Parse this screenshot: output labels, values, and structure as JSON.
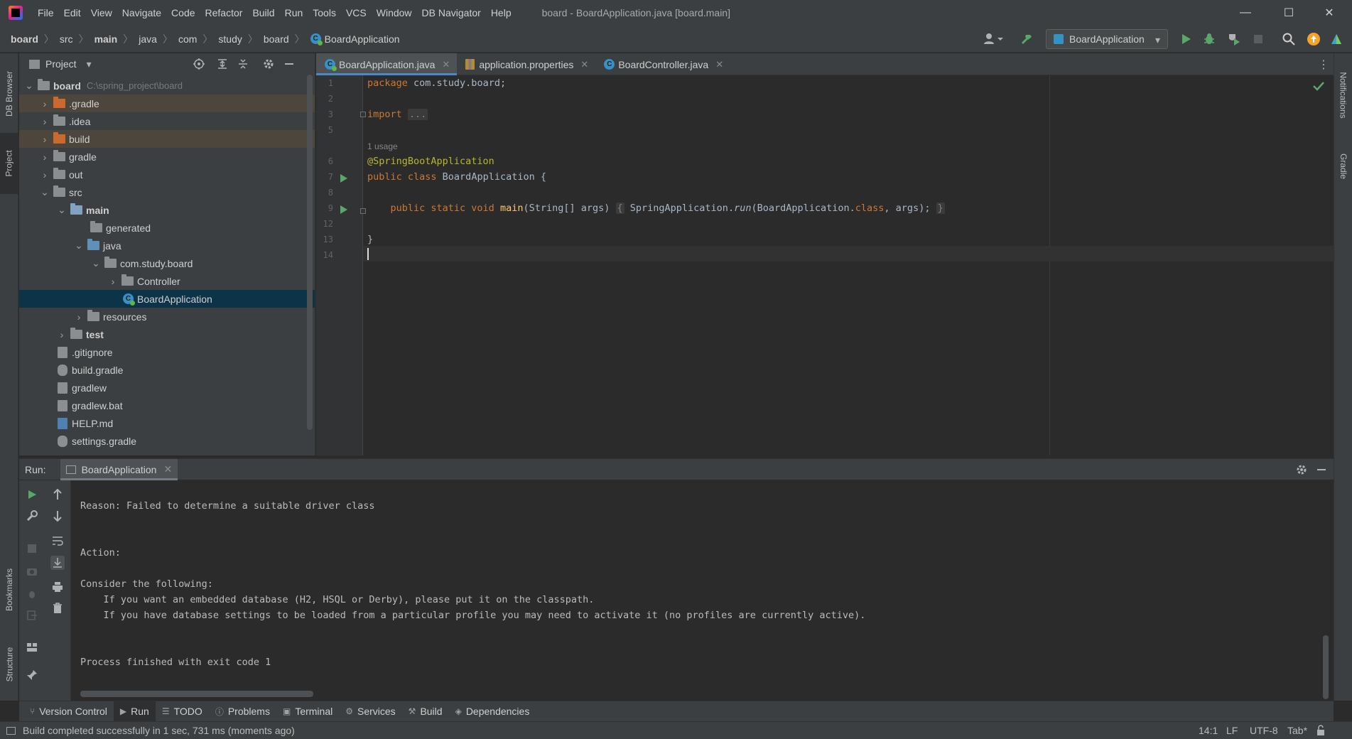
{
  "titlebar": {
    "menu": [
      "File",
      "Edit",
      "View",
      "Navigate",
      "Code",
      "Refactor",
      "Build",
      "Run",
      "Tools",
      "VCS",
      "Window",
      "DB Navigator",
      "Help"
    ],
    "window_title": "board - BoardApplication.java [board.main]",
    "minimize": "—",
    "maximize": "☐",
    "close": "✕"
  },
  "breadcrumb": {
    "items": [
      "board",
      "src",
      "main",
      "java",
      "com",
      "study",
      "board",
      "BoardApplication"
    ],
    "bold": [
      "board",
      "main"
    ]
  },
  "toolbar": {
    "run_config": "BoardApplication",
    "accent_run": "#59a869",
    "accent_update": "#f4a32b"
  },
  "left_strip": {
    "db_browser": "DB Browser",
    "project": "Project",
    "bookmarks": "Bookmarks",
    "structure": "Structure"
  },
  "right_strip": {
    "notifications": "Notifications",
    "gradle": "Gradle"
  },
  "project": {
    "title": "Project",
    "root_name": "board",
    "root_path": "C:\\spring_project\\board",
    "rows": [
      {
        "label": ".gradle",
        "icon": "folder-orange"
      },
      {
        "label": ".idea",
        "icon": "folder-gray"
      },
      {
        "label": "build",
        "icon": "folder-orange"
      },
      {
        "label": "gradle",
        "icon": "folder-gray"
      },
      {
        "label": "out",
        "icon": "folder-gray"
      },
      {
        "label": "src",
        "icon": "folder-gray"
      },
      {
        "label": "main",
        "icon": "folder-gray"
      },
      {
        "label": "generated",
        "icon": "folder-generated"
      },
      {
        "label": "java",
        "icon": "folder-blue"
      },
      {
        "label": "com.study.board",
        "icon": "package"
      },
      {
        "label": "Controller",
        "icon": "package"
      },
      {
        "label": "BoardApplication",
        "icon": "spring-class"
      },
      {
        "label": "resources",
        "icon": "folder-resources"
      },
      {
        "label": "test",
        "icon": "folder-gray"
      },
      {
        "label": ".gitignore",
        "icon": "gitignore-file"
      },
      {
        "label": "build.gradle",
        "icon": "gradle-file"
      },
      {
        "label": "gradlew",
        "icon": "shell-file"
      },
      {
        "label": "gradlew.bat",
        "icon": "bat-file"
      },
      {
        "label": "HELP.md",
        "icon": "markdown-file"
      },
      {
        "label": "settings.gradle",
        "icon": "gradle-file"
      }
    ]
  },
  "editor": {
    "tabs": [
      {
        "label": "BoardApplication.java",
        "active": true
      },
      {
        "label": "application.properties",
        "active": false
      },
      {
        "label": "BoardController.java",
        "active": false
      }
    ],
    "line_numbers": [
      "1",
      "2",
      "3",
      "5",
      "6",
      "7",
      "8",
      "9",
      "12",
      "13",
      "14"
    ],
    "usage_hint": "1 usage",
    "code": {
      "l1_kw": "package",
      "l1_rest": " com.study.board;",
      "l3_kw": "import",
      "l3_fold": "...",
      "l6_ann": "@SpringBootApplication",
      "l7_kw": "public class",
      "l7_rest": " BoardApplication {",
      "l9_kw": "    public static void",
      "l9_fn": " main",
      "l9_args": "(String[] args) ",
      "l9_open": "{",
      "l9_body1": " SpringApplication.",
      "l9_run": "run",
      "l9_body2": "(BoardApplication.",
      "l9_class": "class",
      "l9_body3": ", args); ",
      "l9_close": "}",
      "l13": "}"
    }
  },
  "run": {
    "label": "Run:",
    "tab": "BoardApplication",
    "console": [
      "Reason: Failed to determine a suitable driver class",
      "Action:",
      "Consider the following:",
      "    If you want an embedded database (H2, HSQL or Derby), please put it on the classpath.",
      "    If you have database settings to be loaded from a particular profile you may need to activate it (no profiles are currently active).",
      "Process finished with exit code 1"
    ]
  },
  "tool_tabs": [
    {
      "label": "Version Control",
      "icon": "⑂"
    },
    {
      "label": "Run",
      "icon": "▶",
      "active": true
    },
    {
      "label": "TODO",
      "icon": "☰"
    },
    {
      "label": "Problems",
      "icon": "ⓘ"
    },
    {
      "label": "Terminal",
      "icon": "▣"
    },
    {
      "label": "Services",
      "icon": "⚙"
    },
    {
      "label": "Build",
      "icon": "⚒"
    },
    {
      "label": "Dependencies",
      "icon": "◈"
    }
  ],
  "status": {
    "message": "Build completed successfully in 1 sec, 731 ms (moments ago)",
    "position": "14:1",
    "line_sep": "LF",
    "encoding": "UTF-8",
    "indent": "Tab*"
  }
}
